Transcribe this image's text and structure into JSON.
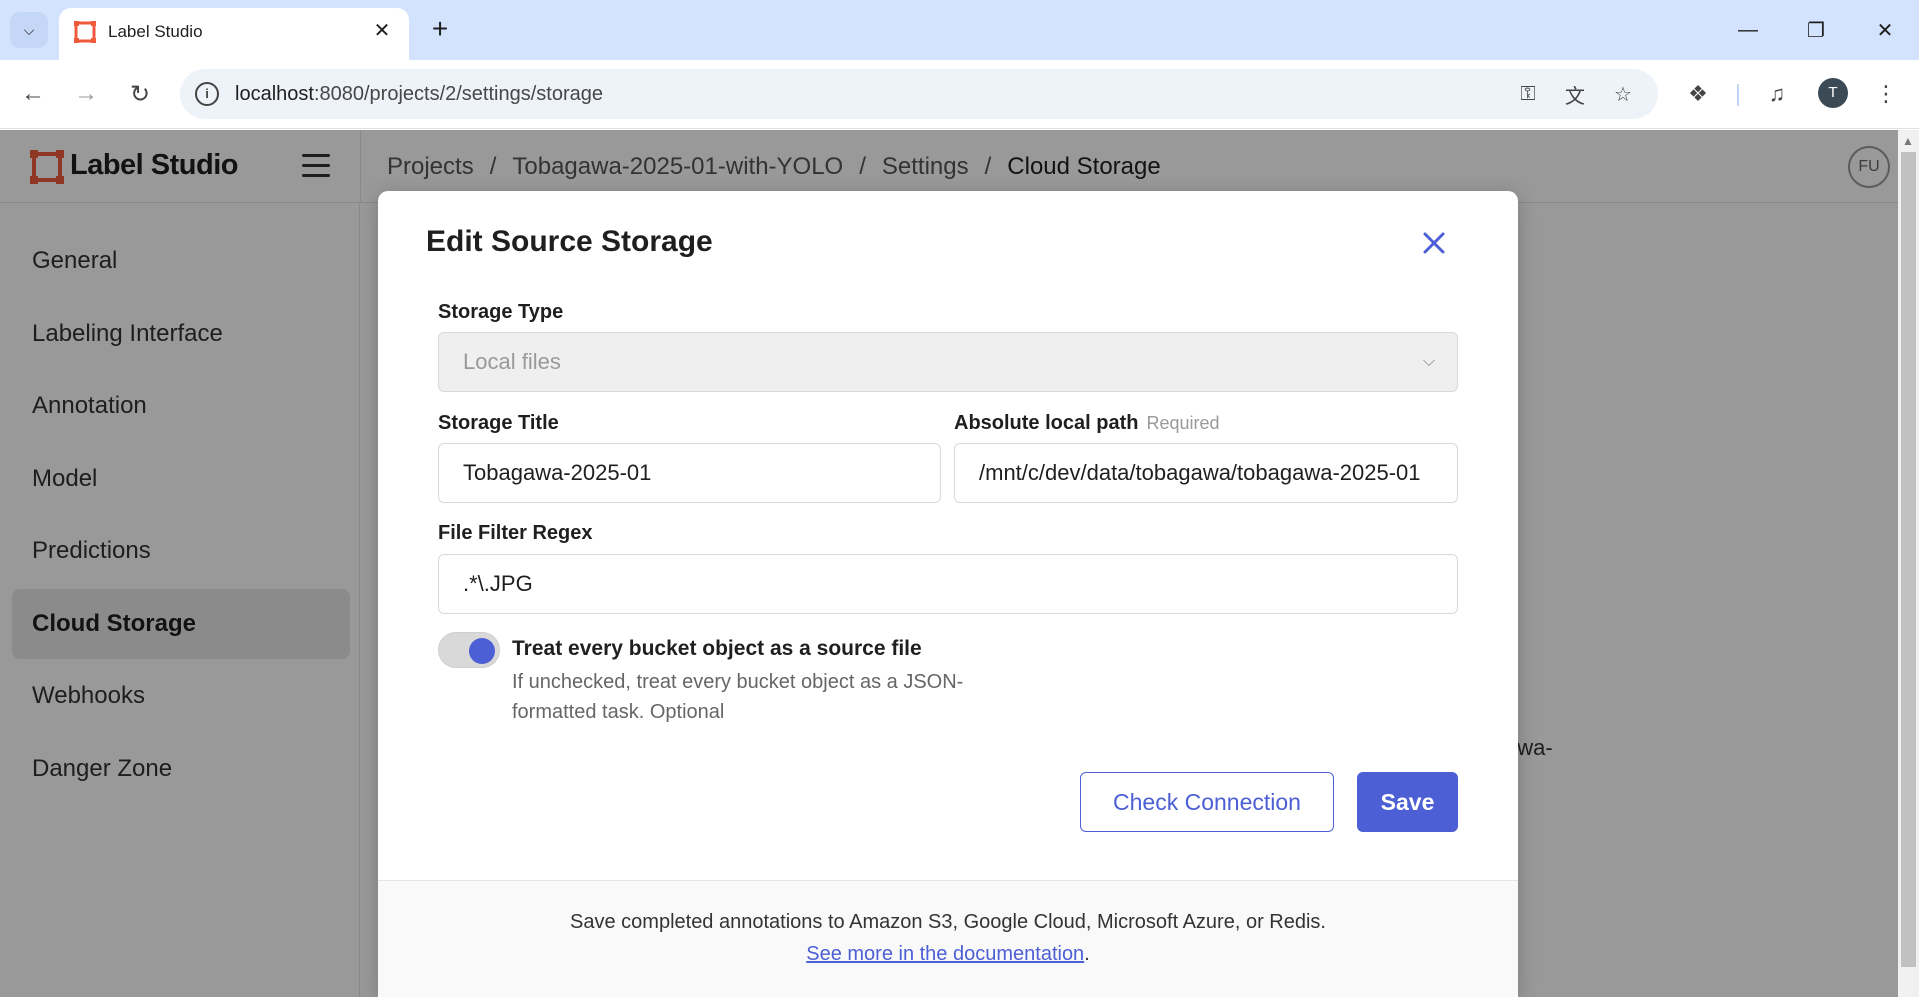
{
  "browser": {
    "tab_title": "Label Studio",
    "url_host": "localhost",
    "url_rest": ":8080/projects/2/settings/storage",
    "profile_initial": "T",
    "icons": [
      "tab-search-icon",
      "close-icon",
      "plus-icon",
      "minimize-icon",
      "restore-icon",
      "back-icon",
      "forward-icon",
      "reload-icon",
      "site-info-icon",
      "key-icon",
      "translate-icon",
      "star-icon",
      "extensions-icon",
      "media-icon",
      "menu-dots-icon"
    ]
  },
  "app": {
    "brand": "Label Studio",
    "breadcrumb": [
      "Projects",
      "Tobagawa-2025-01-with-YOLO",
      "Settings",
      "Cloud Storage"
    ],
    "breadcrumb_sep": "/",
    "user_initials": "FU",
    "sidebar": [
      {
        "label": "General"
      },
      {
        "label": "Labeling Interface"
      },
      {
        "label": "Annotation"
      },
      {
        "label": "Model"
      },
      {
        "label": "Predictions"
      },
      {
        "label": "Cloud Storage"
      },
      {
        "label": "Webhooks"
      },
      {
        "label": "Danger Zone"
      }
    ],
    "active_sidebar": "Cloud Storage",
    "background_fragment": "awa-"
  },
  "modal": {
    "title": "Edit Source Storage",
    "storage_type_label": "Storage Type",
    "storage_type_value": "Local files",
    "storage_title_label": "Storage Title",
    "storage_title_value": "Tobagawa-2025-01",
    "local_path_label": "Absolute local path",
    "local_path_required": "Required",
    "local_path_value": "/mnt/c/dev/data/tobagawa/tobagawa-2025-01",
    "regex_label": "File Filter Regex",
    "regex_value": ".*\\.JPG",
    "toggle_label": "Treat every bucket object as a source file",
    "toggle_on": true,
    "toggle_desc": "If unchecked, treat every bucket object as a JSON-formatted task. Optional",
    "check_button": "Check Connection",
    "save_button": "Save",
    "footer_text": "Save completed annotations to Amazon S3, Google Cloud, Microsoft Azure, or Redis.",
    "footer_link": "See more in the documentation",
    "footer_period": ".",
    "accent_color": "#4c5fd5"
  }
}
